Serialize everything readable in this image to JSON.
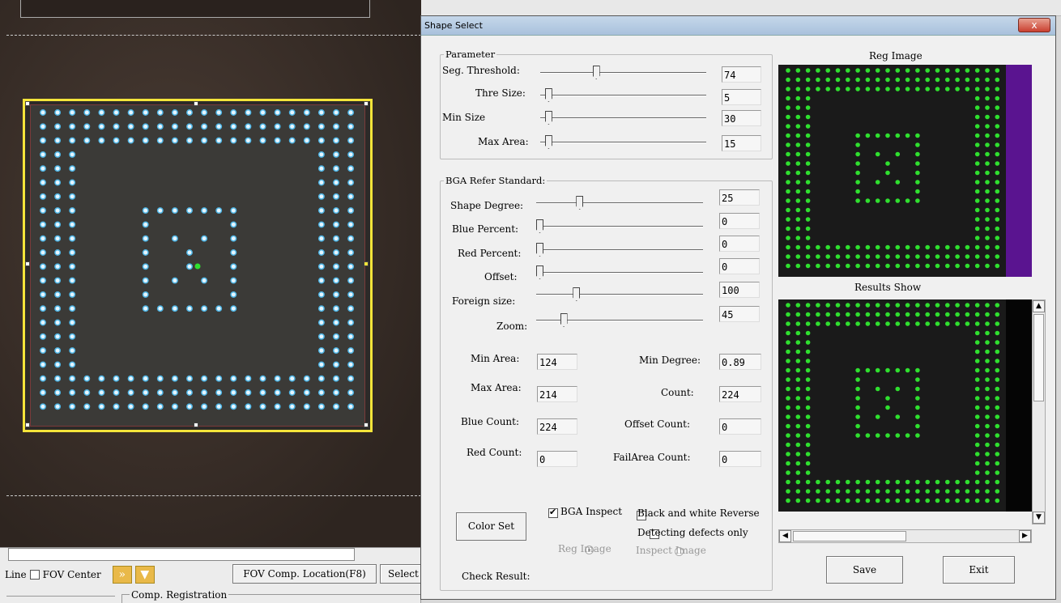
{
  "background_app": {
    "toolbar": {
      "line_label": "Line",
      "fov_center_label": "FOV Center",
      "fov_comp_location_button": "FOV Comp. Location(F8)",
      "select_button": "Select"
    },
    "comp_registration_label": "Comp. Registration"
  },
  "dialog": {
    "title": "Shape Select",
    "close_glyph": "x",
    "parameter": {
      "group_title": "Parameter",
      "seg_threshold": {
        "label": "Seg. Threshold:",
        "value": "74",
        "position": 0.33
      },
      "thre_size": {
        "label": "Thre Size:",
        "value": "5",
        "position": 0.03
      },
      "min_size": {
        "label": "Min Size",
        "value": "30",
        "position": 0.03
      },
      "max_area": {
        "label": "Max Area:",
        "value": "15",
        "position": 0.03
      }
    },
    "bga_refer_standard": {
      "group_title": "BGA Refer Standard:",
      "shape_degree": {
        "label": "Shape Degree:",
        "value": "25",
        "position": 0.25
      },
      "blue_percent": {
        "label": "Blue Percent:",
        "value": "0",
        "position": 0.0
      },
      "red_percent": {
        "label": "Red Percent:",
        "value": "0",
        "position": 0.0
      },
      "offset": {
        "label": "Offset:",
        "value": "0",
        "position": 0.0
      },
      "foreign_size": {
        "label": "Foreign size:",
        "value": "100",
        "position": 0.23
      },
      "zoom": {
        "label": "Zoom:",
        "value": "45",
        "position": 0.15
      },
      "min_area": {
        "label": "Min Area:",
        "value": "124"
      },
      "max_area": {
        "label": "Max Area:",
        "value": "214"
      },
      "blue_count": {
        "label": "Blue Count:",
        "value": "224"
      },
      "red_count": {
        "label": "Red Count:",
        "value": "0"
      },
      "min_degree": {
        "label": "Min Degree:",
        "value": "0.89"
      },
      "count": {
        "label": "Count:",
        "value": "224"
      },
      "offset_count": {
        "label": "Offset Count:",
        "value": "0"
      },
      "failarea_count": {
        "label": "FailArea Count:",
        "value": "0"
      }
    },
    "options": {
      "bga_inspect": {
        "label": "BGA Inspect",
        "checked": true
      },
      "black_white_reverse": {
        "label": "Black and white Reverse",
        "checked": false
      },
      "detecting_defects_only": {
        "label": "Detecting defects only",
        "checked": false
      },
      "reg_image_radio": {
        "label": "Reg Image",
        "selected": true
      },
      "inspect_image_radio": {
        "label": "Inspect Image",
        "selected": false
      }
    },
    "color_set_button": "Color Set",
    "check_result_label": "Check Result:",
    "reg_image_title": "Reg Image",
    "results_show_title": "Results Show",
    "save_button": "Save",
    "exit_button": "Exit"
  },
  "colors": {
    "ball_green": "#2fe02f",
    "ball_blue": "#4fb6e6",
    "selection_yellow": "#f4e43a",
    "reg_image_bar": "#5a1490"
  }
}
